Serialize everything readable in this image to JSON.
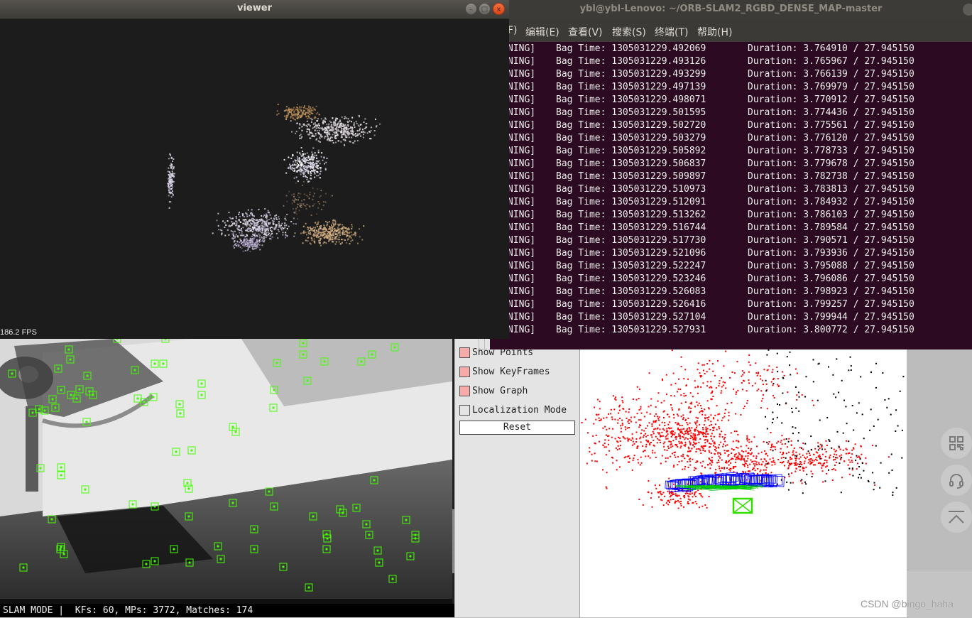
{
  "viewer": {
    "title": "viewer",
    "fps": "186.2 FPS",
    "background": "#1c1c1c"
  },
  "terminal": {
    "title": "ybl@ybl-Lenovo: ~/ORB-SLAM2_RGBD_DENSE_MAP-master",
    "menu": [
      "F)",
      "编辑(E)",
      "查看(V)",
      "搜索(S)",
      "终端(T)",
      "帮助(H)"
    ],
    "background": "#2c0b22",
    "lines": [
      {
        "prefix": "NING]",
        "bag_time": "Bag Time: 1305031229.492069",
        "duration": "Duration: 3.764910 / 27.945150"
      },
      {
        "prefix": "NING]",
        "bag_time": "Bag Time: 1305031229.493126",
        "duration": "Duration: 3.765967 / 27.945150"
      },
      {
        "prefix": "NING]",
        "bag_time": "Bag Time: 1305031229.493299",
        "duration": "Duration: 3.766139 / 27.945150"
      },
      {
        "prefix": "NING]",
        "bag_time": "Bag Time: 1305031229.497139",
        "duration": "Duration: 3.769979 / 27.945150"
      },
      {
        "prefix": "NING]",
        "bag_time": "Bag Time: 1305031229.498071",
        "duration": "Duration: 3.770912 / 27.945150"
      },
      {
        "prefix": "NING]",
        "bag_time": "Bag Time: 1305031229.501595",
        "duration": "Duration: 3.774436 / 27.945150"
      },
      {
        "prefix": "NING]",
        "bag_time": "Bag Time: 1305031229.502720",
        "duration": "Duration: 3.775561 / 27.945150"
      },
      {
        "prefix": "NING]",
        "bag_time": "Bag Time: 1305031229.503279",
        "duration": "Duration: 3.776120 / 27.945150"
      },
      {
        "prefix": "NING]",
        "bag_time": "Bag Time: 1305031229.505892",
        "duration": "Duration: 3.778733 / 27.945150"
      },
      {
        "prefix": "NING]",
        "bag_time": "Bag Time: 1305031229.506837",
        "duration": "Duration: 3.779678 / 27.945150"
      },
      {
        "prefix": "NING]",
        "bag_time": "Bag Time: 1305031229.509897",
        "duration": "Duration: 3.782738 / 27.945150"
      },
      {
        "prefix": "NING]",
        "bag_time": "Bag Time: 1305031229.510973",
        "duration": "Duration: 3.783813 / 27.945150"
      },
      {
        "prefix": "NING]",
        "bag_time": "Bag Time: 1305031229.512091",
        "duration": "Duration: 3.784932 / 27.945150"
      },
      {
        "prefix": "NING]",
        "bag_time": "Bag Time: 1305031229.513262",
        "duration": "Duration: 3.786103 / 27.945150"
      },
      {
        "prefix": "NING]",
        "bag_time": "Bag Time: 1305031229.516744",
        "duration": "Duration: 3.789584 / 27.945150"
      },
      {
        "prefix": "NING]",
        "bag_time": "Bag Time: 1305031229.517730",
        "duration": "Duration: 3.790571 / 27.945150"
      },
      {
        "prefix": "NING]",
        "bag_time": "Bag Time: 1305031229.521096",
        "duration": "Duration: 3.793936 / 27.945150"
      },
      {
        "prefix": "NING]",
        "bag_time": "Bag Time: 1305031229.522247",
        "duration": "Duration: 3.795088 / 27.945150"
      },
      {
        "prefix": "NING]",
        "bag_time": "Bag Time: 1305031229.523246",
        "duration": "Duration: 3.796086 / 27.945150"
      },
      {
        "prefix": "NING]",
        "bag_time": "Bag Time: 1305031229.526083",
        "duration": "Duration: 3.798923 / 27.945150"
      },
      {
        "prefix": "NING]",
        "bag_time": "Bag Time: 1305031229.526416",
        "duration": "Duration: 3.799257 / 27.945150"
      },
      {
        "prefix": "NING]",
        "bag_time": "Bag Time: 1305031229.527104",
        "duration": "Duration: 3.799944 / 27.945150"
      },
      {
        "prefix": "NING]",
        "bag_time": "Bag Time: 1305031229.527931",
        "duration": "Duration: 3.800772 / 27.945150"
      }
    ]
  },
  "frame": {
    "status": "SLAM MODE |  KFs: 60, MPs: 3772, Matches: 174",
    "feature_color": "#44ff00"
  },
  "map_viewer": {
    "checkboxes": [
      {
        "label": "Show Points",
        "checked": true
      },
      {
        "label": "Show KeyFrames",
        "checked": true
      },
      {
        "label": "Show Graph",
        "checked": true
      },
      {
        "label": "Localization Mode",
        "checked": false
      }
    ],
    "reset_label": "Reset",
    "colors": {
      "map_points": "#ff0000",
      "ref_points": "#000000",
      "keyframes": "#0000ff",
      "graph": "#00cc00",
      "current_camera": "#33dd00"
    }
  },
  "side_rail": {
    "buttons": [
      {
        "icon": "qr-code-icon"
      },
      {
        "icon": "headset-icon"
      },
      {
        "icon": "back-to-top-icon"
      }
    ]
  },
  "watermark": "CSDN @bingo_haha",
  "window_buttons": {
    "minimize": "–",
    "maximize": "□",
    "close": "x"
  }
}
